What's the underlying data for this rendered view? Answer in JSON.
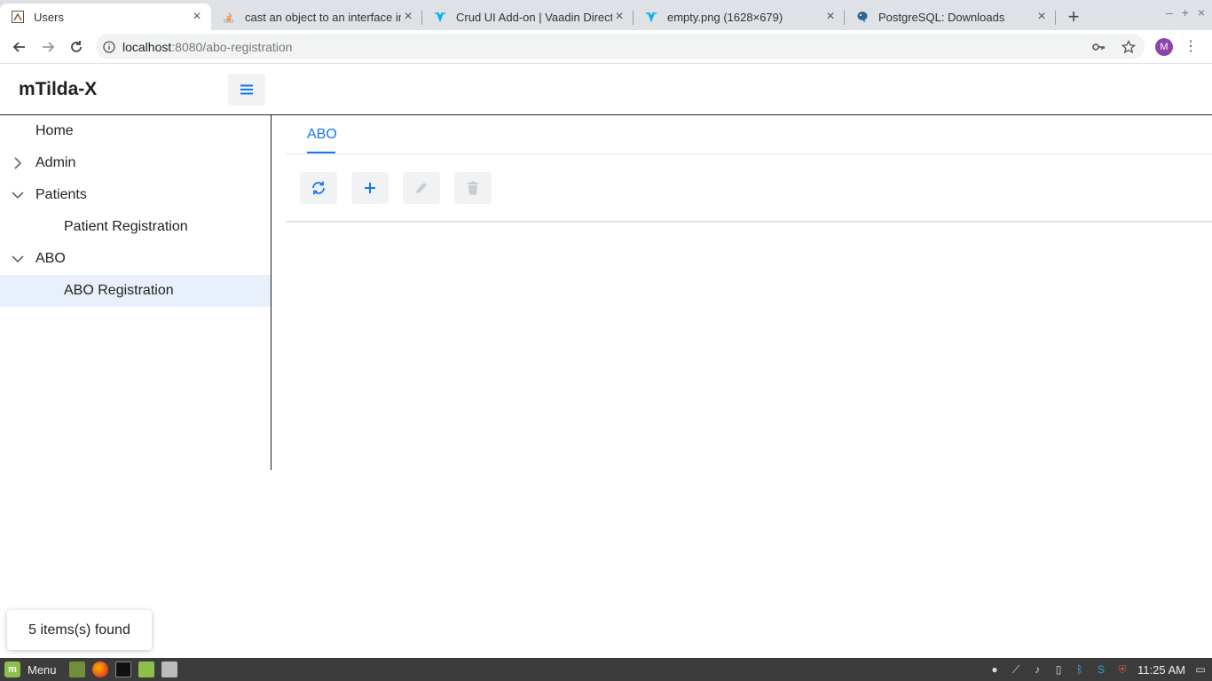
{
  "browser": {
    "tabs": [
      {
        "title": "Users",
        "active": true,
        "favicon": "app-icon"
      },
      {
        "title": "cast an object to an interface in",
        "active": false,
        "favicon": "stackoverflow-icon"
      },
      {
        "title": "Crud UI Add-on | Vaadin Direct",
        "active": false,
        "favicon": "vaadin-icon"
      },
      {
        "title": "empty.png (1628×679)",
        "active": false,
        "favicon": "vaadin-icon"
      },
      {
        "title": "PostgreSQL: Downloads",
        "active": false,
        "favicon": "postgresql-icon"
      }
    ],
    "url_host": "localhost",
    "url_path": ":8080/abo-registration",
    "profile_initial": "M"
  },
  "app": {
    "title": "mTilda-X"
  },
  "drawer": {
    "items": [
      {
        "label": "Home"
      },
      {
        "label": "Admin",
        "state": "collapsed"
      },
      {
        "label": "Patients",
        "state": "expanded"
      },
      {
        "label": "Patient Registration"
      },
      {
        "label": "ABO",
        "state": "expanded"
      },
      {
        "label": "ABO Registration",
        "selected": true
      }
    ]
  },
  "main": {
    "tab_label": "ABO",
    "buttons": [
      "refresh-icon",
      "plus-icon",
      "pencil-icon",
      "trash-icon"
    ]
  },
  "notification": {
    "text": "5 items(s) found"
  },
  "taskbar": {
    "menu_label": "Menu",
    "clock": "11:25 AM"
  },
  "colors": {
    "accent": "#1676f3",
    "selected_bg": "#e8f0fb",
    "taskbar": "#3c3c3c"
  }
}
